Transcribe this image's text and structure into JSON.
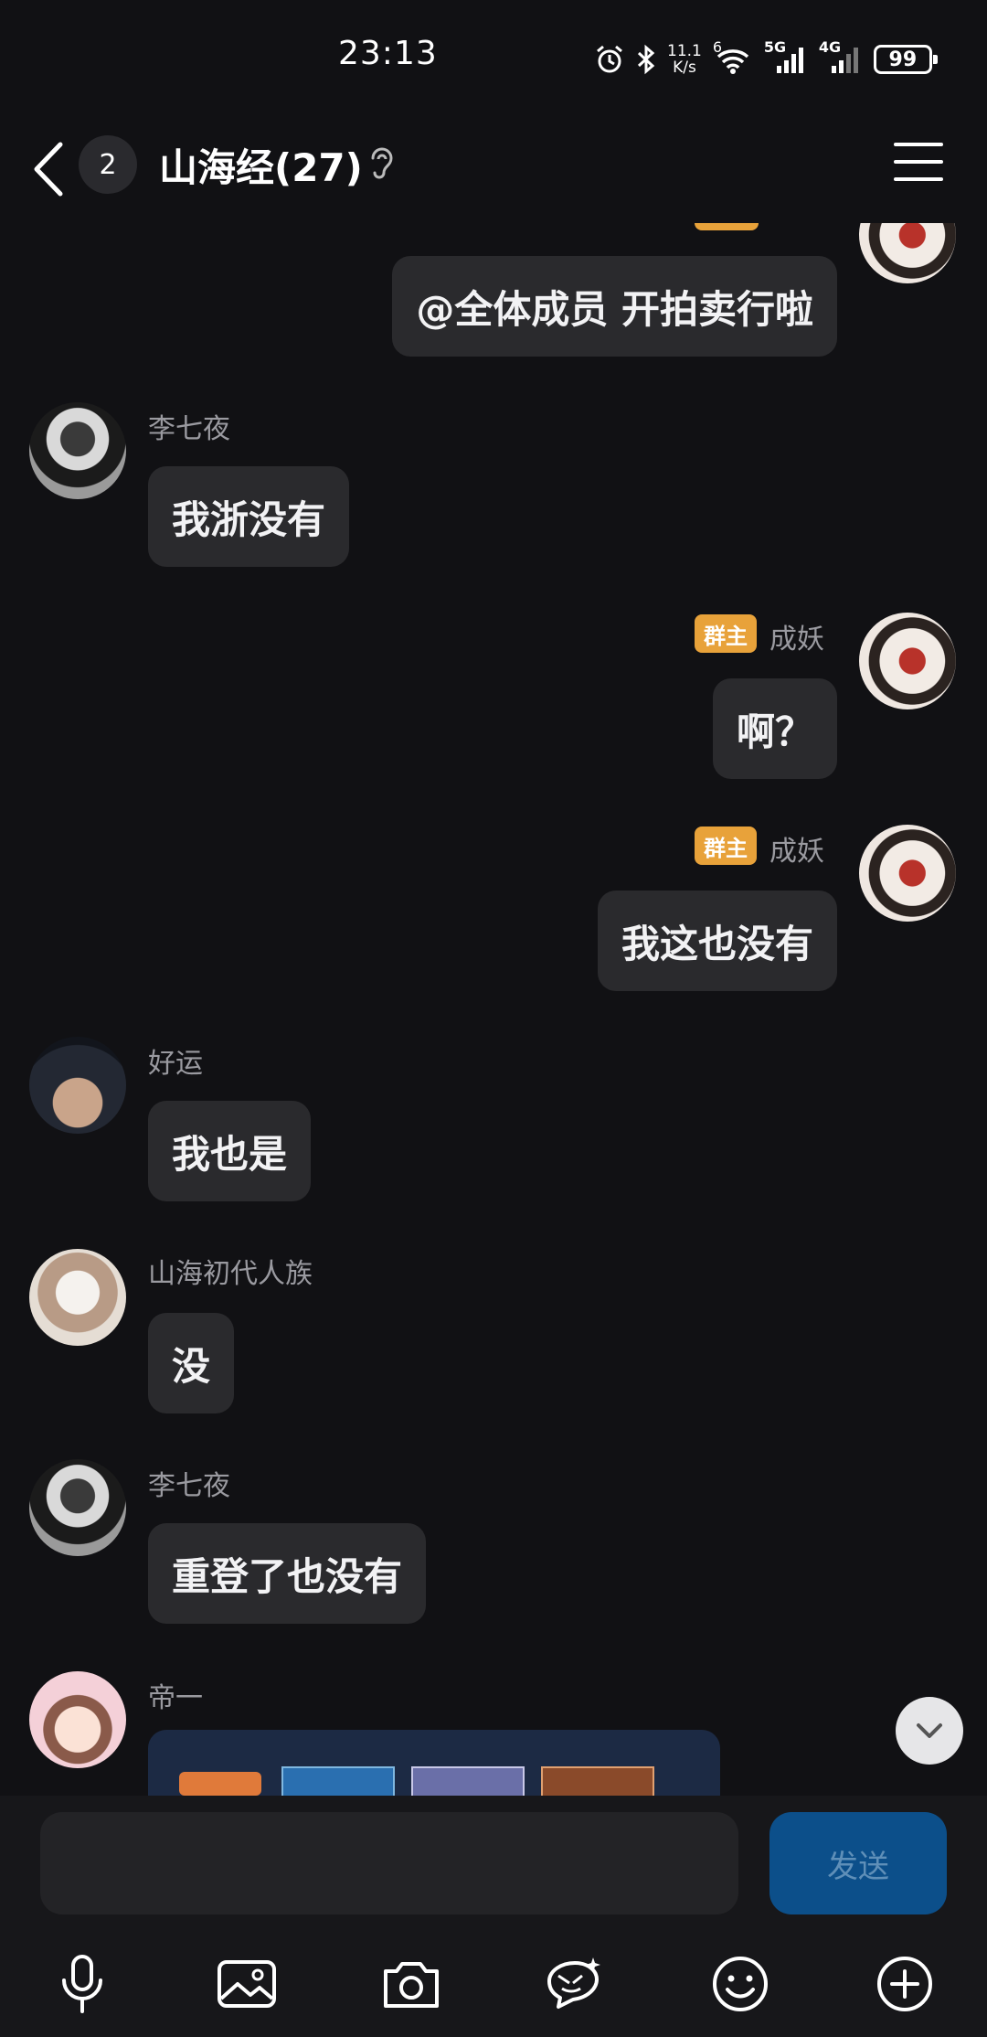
{
  "status_bar": {
    "time": "23:13",
    "net_speed_value": "11.1",
    "net_speed_unit": "K/s",
    "wifi_sup": "6",
    "sim1_label": "5G",
    "sim2_label": "4G",
    "battery": "99"
  },
  "header": {
    "unread_count": "2",
    "title": "山海经(27)"
  },
  "messages": [
    {
      "sender": "",
      "side": "right",
      "text": "@全体成员 开拍卖行啦"
    },
    {
      "sender": "李七夜",
      "side": "left",
      "text": "我浙没有"
    },
    {
      "sender": "成妖",
      "badge": "群主",
      "side": "right",
      "text": "啊？"
    },
    {
      "sender": "成妖",
      "badge": "群主",
      "side": "right",
      "text": "我这也没有"
    },
    {
      "sender": "好运",
      "side": "left",
      "text": "我也是"
    },
    {
      "sender": "山海初代人族",
      "side": "left",
      "text": "没"
    },
    {
      "sender": "李七夜",
      "side": "left",
      "text": "重登了也没有"
    },
    {
      "sender": "帝一",
      "side": "left",
      "text": ""
    }
  ],
  "composer": {
    "input_value": "",
    "send_label": "发送"
  },
  "toolbar": {
    "icons": [
      "microphone-icon",
      "image-icon",
      "camera-icon",
      "sticker-icon",
      "emoji-icon",
      "plus-icon"
    ]
  },
  "colors": {
    "background": "#111114",
    "bubble": "#2a2a2d",
    "owner_badge": "#e8a23a",
    "send_button": "#0c4f8a"
  }
}
